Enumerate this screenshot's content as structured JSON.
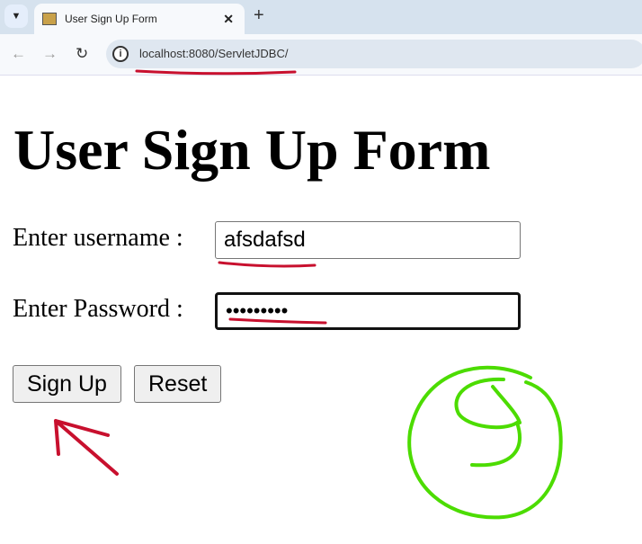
{
  "browser": {
    "tab_title": "User Sign Up Form",
    "url_host": "localhost",
    "url_rest": ":8080/ServletJDBC/",
    "icons": {
      "tab_menu": "chevron-down-icon",
      "close": "close-icon",
      "new_tab": "plus-icon",
      "back": "arrow-left-icon",
      "forward": "arrow-right-icon",
      "reload": "reload-icon",
      "info": "info-icon"
    }
  },
  "page": {
    "title": "User Sign Up Form",
    "username_label": "Enter username :",
    "username_value": "afsdafsd",
    "password_label": "Enter Password :",
    "password_value": "•••••••••",
    "signup_label": "Sign Up",
    "reset_label": "Reset"
  },
  "annotation_colors": {
    "red": "#c8102e",
    "green": "#4cdc00"
  }
}
